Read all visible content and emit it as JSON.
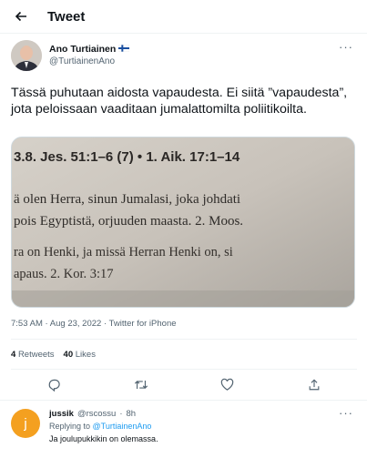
{
  "header": {
    "title": "Tweet"
  },
  "tweet": {
    "author_name": "Ano Turtiainen",
    "author_handle": "@TurtiainenAno",
    "flag_icon": "finland-flag-icon",
    "text": "Tässä puhutaan aidosta vapaudesta. Ei siitä ”vapaudesta”, jota peloissaan vaaditaan jumalattomilta poliitikoilta.",
    "media_lines": [
      "3.8.   Jes. 51:1–6 (7) • 1. Aik. 17:1–14",
      "ä olen Herra, sinun Jumalasi, joka johdati",
      "pois Egyptistä, orjuuden maasta. 2. Moos.",
      "ra on Henki, ja missä Herran Henki on, si",
      "apaus. 2. Kor. 3:17"
    ],
    "time": "7:53 AM",
    "date": "Aug 23, 2022",
    "source": "Twitter for iPhone",
    "retweets_count": "4",
    "retweets_label": "Retweets",
    "likes_count": "40",
    "likes_label": "Likes"
  },
  "reply": {
    "avatar_letter": "j",
    "name": "jussik",
    "handle": "@rscossu",
    "age": "8h",
    "replying_prefix": "Replying to",
    "replying_to": "@TurtiainenAno",
    "text": "Ja joulupukkikin on olemassa."
  },
  "colors": {
    "accent": "#1d9bf0",
    "muted": "#536471",
    "reply_avatar": "#f4a020"
  }
}
